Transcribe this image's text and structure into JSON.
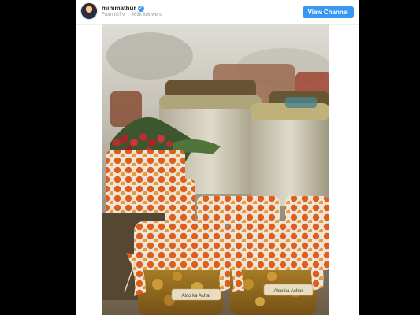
{
  "post": {
    "username": "minimathur",
    "source": "From IGTV",
    "followers": "469k followers",
    "view_channel_label": "View Channel",
    "verified_icon": "check-icon"
  },
  "image": {
    "jar_labels": [
      "Aloo ka Achar",
      "Aloo ka Achar"
    ]
  },
  "colors": {
    "accent": "#3897f0",
    "dots": "#e8631f"
  }
}
